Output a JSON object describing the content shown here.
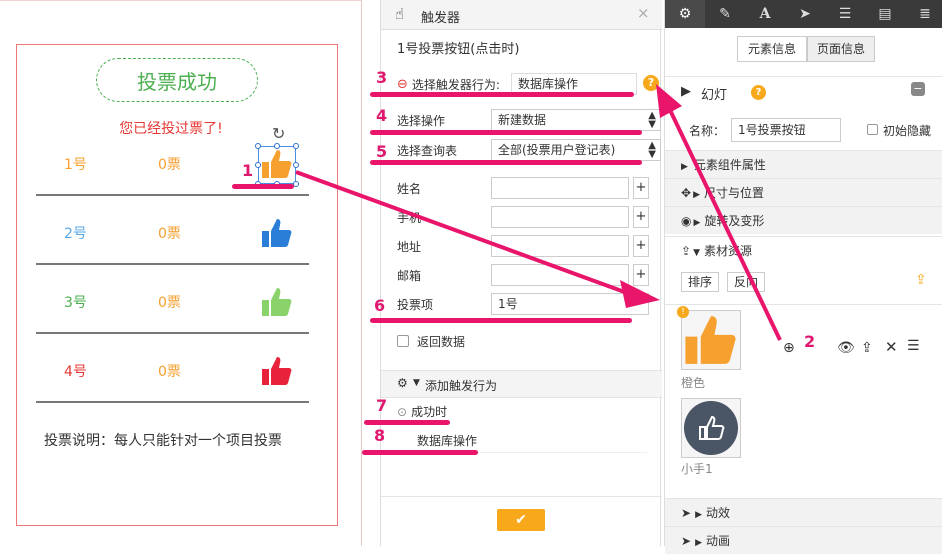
{
  "canvas": {
    "success_title": "投票成功",
    "voted_msg": "您已经投过票了!",
    "rows": [
      {
        "name": "1号",
        "count": "0票",
        "color": "#f6a030"
      },
      {
        "name": "2号",
        "count": "0票",
        "color": "#5aa9e6"
      },
      {
        "name": "3号",
        "count": "0票",
        "color": "#4caf50"
      },
      {
        "name": "4号",
        "count": "0票",
        "color": "#e53935"
      }
    ],
    "thumb_colors": [
      "#f6a030",
      "#2a7ed8",
      "#8ad36a",
      "#e8223a"
    ],
    "rules": "投票说明：每人只能针对一个项目投票"
  },
  "trigger_panel": {
    "title": "触发器",
    "subtitle": "1号投票按钮(点击时)",
    "behavior_label": "选择触发器行为:",
    "behavior_value": "数据库操作",
    "op_label": "选择操作",
    "op_value": "新建数据",
    "query_label": "选择查询表",
    "query_value": "全部(投票用户登记表)",
    "fields": [
      {
        "label": "姓名",
        "value": ""
      },
      {
        "label": "手机",
        "value": ""
      },
      {
        "label": "地址",
        "value": ""
      },
      {
        "label": "邮箱",
        "value": ""
      }
    ],
    "vote_label": "投票项",
    "vote_value": "1号",
    "return_label": "返回数据",
    "add_trigger": "添加触发行为",
    "success_label": "成功时",
    "db_op": "数据库操作"
  },
  "right_panel": {
    "tab_element": "元素信息",
    "tab_page": "页面信息",
    "slide_label": "幻灯",
    "name_label": "名称：",
    "name_value": "1号投票按钮",
    "hide_label": "初始隐藏",
    "sections": [
      "元素组件属性",
      "尺寸与位置",
      "旋转及变形",
      "素材资源"
    ],
    "sort_btn": "排序",
    "reverse_btn": "反向",
    "assets": [
      {
        "label": "橙色",
        "color": "#f6a030"
      },
      {
        "label": "小手1",
        "color": "#4a5566"
      }
    ],
    "bottom_sections": [
      "动效",
      "动画"
    ]
  },
  "markers": [
    "1",
    "2",
    "3",
    "4",
    "5",
    "6",
    "7",
    "8"
  ],
  "accent": "#e8156b"
}
